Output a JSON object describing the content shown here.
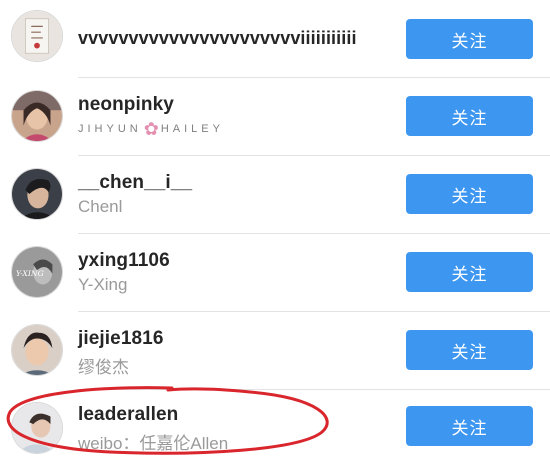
{
  "follow_list": {
    "accent_color": "#3d97f0",
    "annotation_color": "#d9262c",
    "items": [
      {
        "username": "vvvvvvvvvvvvvvvvvvvvvviiiiiiiiiii",
        "subtitle": "",
        "follow_label": "关注"
      },
      {
        "username": "neonpinky",
        "subtitle_left": "JIHYUN",
        "subtitle_icon": "cherry-blossom-icon",
        "subtitle_right": "HAILEY",
        "follow_label": "关注"
      },
      {
        "username": "__chen__i__",
        "subtitle": "Chenl",
        "follow_label": "关注"
      },
      {
        "username": "yxing1106",
        "subtitle": "Y-Xing",
        "avatar_text": "Y-XING",
        "follow_label": "关注"
      },
      {
        "username": "jiejie1816",
        "subtitle": "缪俊杰",
        "follow_label": "关注"
      },
      {
        "username": "leaderallen",
        "subtitle": "weibo：任嘉伦Allen",
        "follow_label": "关注"
      }
    ]
  }
}
